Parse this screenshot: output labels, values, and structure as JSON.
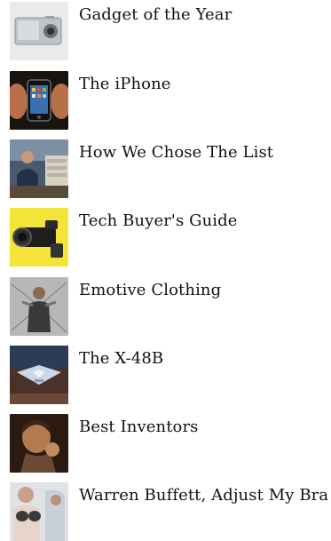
{
  "articles": [
    {
      "title": "Gadget of the Year",
      "thumb": "camera-thumbnail"
    },
    {
      "title": "The iPhone",
      "thumb": "iphone-thumbnail"
    },
    {
      "title": "How We Chose The List",
      "thumb": "person-desk-thumbnail"
    },
    {
      "title": "Tech Buyer's Guide",
      "thumb": "camcorder-thumbnail"
    },
    {
      "title": "Emotive Clothing",
      "thumb": "clothing-thumbnail"
    },
    {
      "title": "The X-48B",
      "thumb": "aircraft-thumbnail"
    },
    {
      "title": "Best Inventors",
      "thumb": "inventor-thumbnail"
    },
    {
      "title": "Warren Buffett, Adjust My Bra",
      "thumb": "bra-thumbnail"
    }
  ]
}
